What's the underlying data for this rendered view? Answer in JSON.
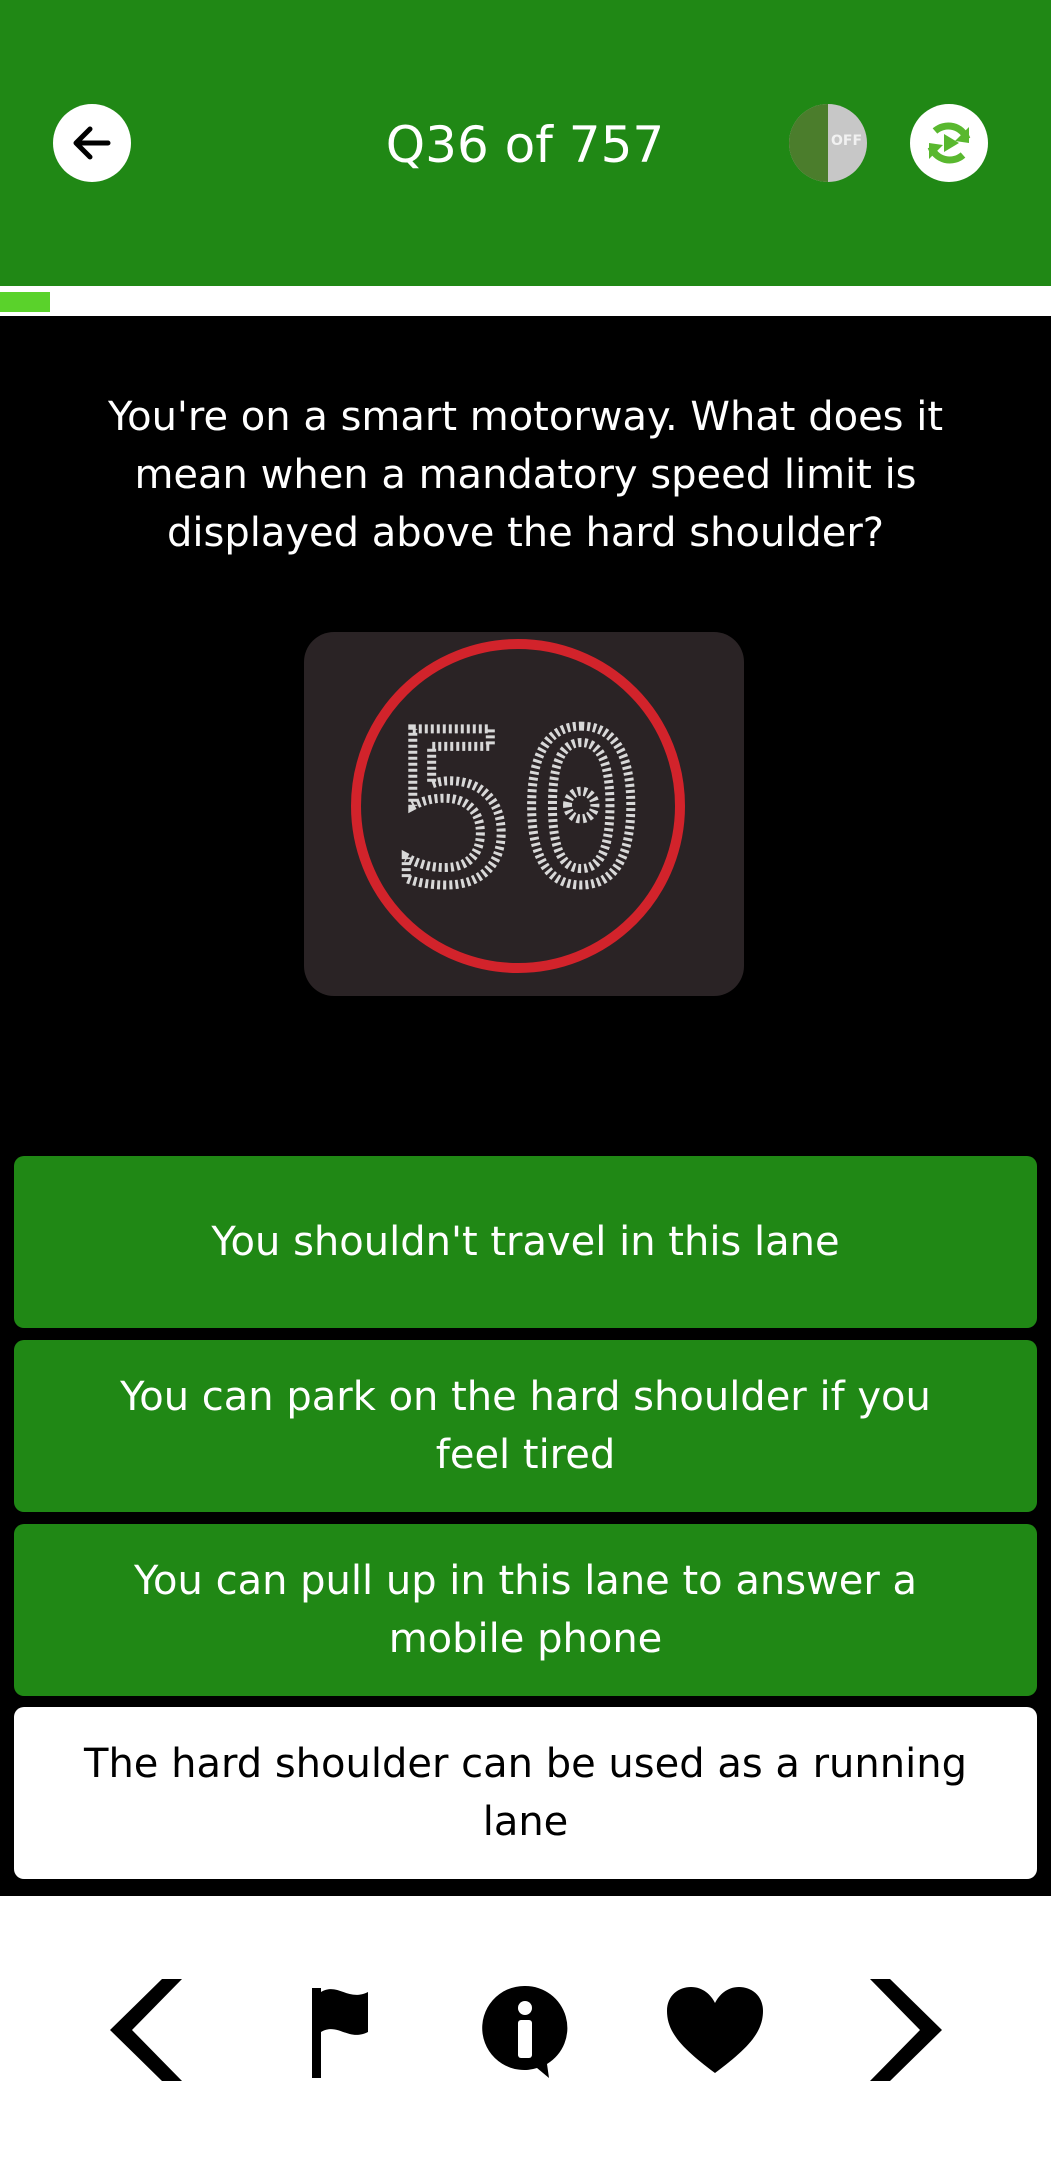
{
  "header": {
    "title": "Q36 of 757",
    "voice_toggle_label": "OFF",
    "colors": {
      "header_bg": "#208815",
      "progress": "#5ad22b"
    }
  },
  "progress": {
    "current": 36,
    "total": 757,
    "fraction": 0.0476
  },
  "question": {
    "text": "You're on a smart motorway. What does it mean when a mandatory speed limit is displayed above the hard shoulder?",
    "sign_value": "50"
  },
  "answers": [
    {
      "text": "You shouldn't travel in this lane",
      "selected": false
    },
    {
      "text": "You can park on the hard shoulder if you feel tired",
      "selected": false
    },
    {
      "text": "You can pull up in this lane to answer a mobile phone",
      "selected": false
    },
    {
      "text": "The hard shoulder can be used as a running lane",
      "selected": true
    }
  ],
  "bottom_nav": {
    "icons": [
      "chevron-left-icon",
      "flag-icon",
      "info-icon",
      "heart-icon",
      "chevron-right-icon"
    ]
  }
}
